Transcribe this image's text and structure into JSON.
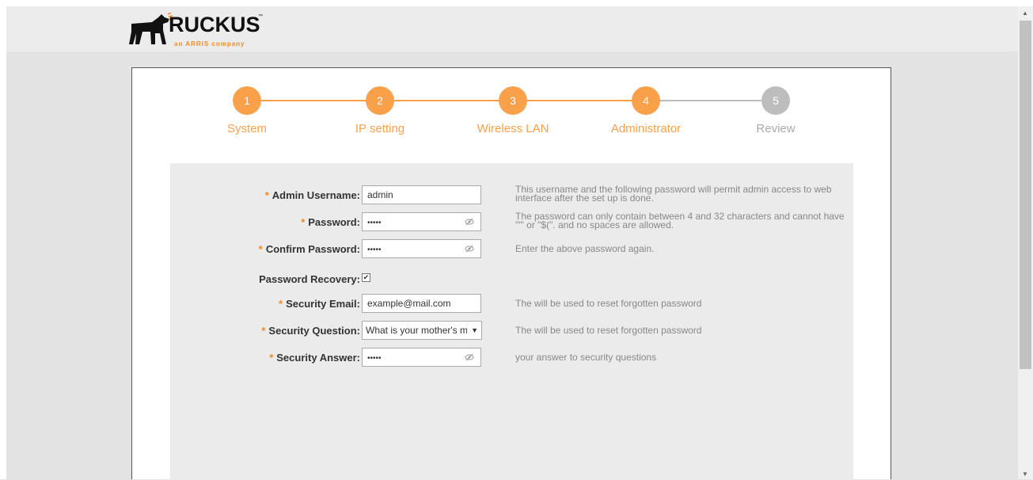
{
  "brand": {
    "name": "RUCKUS",
    "tagline": "an ARRIS company",
    "trademark": "™",
    "accent": "#f08a1d"
  },
  "wizard": {
    "active_color": "#f9a04b",
    "inactive_color": "#bdbdbd",
    "steps": [
      {
        "number": "1",
        "label": "System",
        "state": "done"
      },
      {
        "number": "2",
        "label": "IP setting",
        "state": "done"
      },
      {
        "number": "3",
        "label": "Wireless LAN",
        "state": "done"
      },
      {
        "number": "4",
        "label": "Administrator",
        "state": "current"
      },
      {
        "number": "5",
        "label": "Review",
        "state": "pending"
      }
    ]
  },
  "form": {
    "required_mark": "*",
    "admin_username": {
      "label": "Admin Username:",
      "value": "admin",
      "hint": "This username and the following password will permit admin access to web interface after the set up is done."
    },
    "password": {
      "label": "Password:",
      "value": "•••••",
      "hint": "The password can only contain between 4 and 32 characters and cannot have \"'\" or \"$(\". and no spaces are allowed."
    },
    "confirm_password": {
      "label": "Confirm Password:",
      "value": "•••••",
      "hint": "Enter the above password again."
    },
    "password_recovery": {
      "label": "Password Recovery:",
      "checked": true,
      "check_glyph": "✔"
    },
    "security_email": {
      "label": "Security Email:",
      "value": "example@mail.com",
      "hint": "The will be used to reset forgotten password"
    },
    "security_question": {
      "label": "Security Question:",
      "value": "What is your mother's maiden name?",
      "hint": "The will be used to reset forgotten password",
      "arrow": "▼"
    },
    "security_answer": {
      "label": "Security Answer:",
      "value": "•••••",
      "hint": "your answer to security questions"
    }
  },
  "scrollbar": {
    "up": "▲",
    "down": "▼"
  }
}
